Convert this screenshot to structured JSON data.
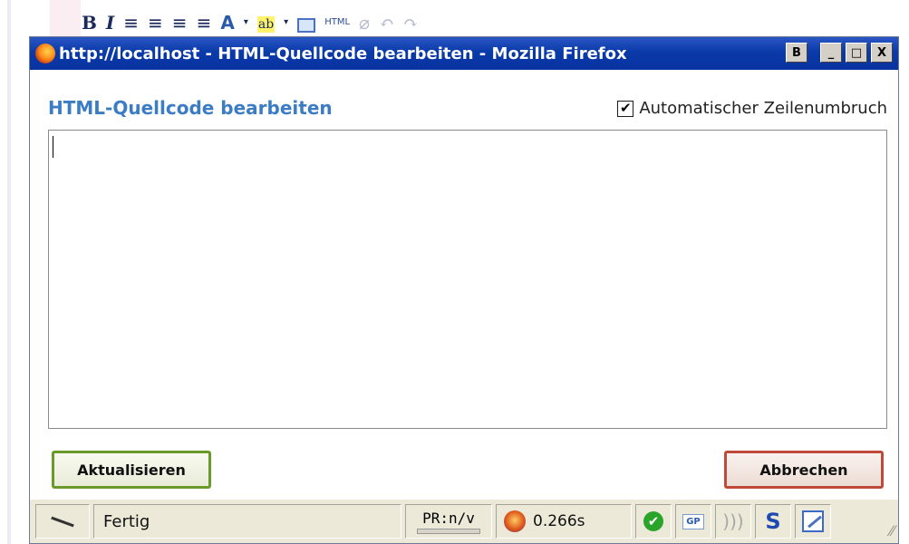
{
  "background_toolbar": {
    "bold": "B",
    "italic": "I",
    "align_left": "≡",
    "align_center": "≡",
    "align_right": "≡",
    "align_justify": "≡",
    "font_color": "A",
    "font_color_caret": "▾",
    "highlight": "ab",
    "highlight_caret": "▾",
    "html_label": "HTML",
    "undo": "↶",
    "redo": "↷"
  },
  "window": {
    "title": "http://localhost - HTML-Quellcode bearbeiten - Mozilla Firefox",
    "btn_extra": "B",
    "btn_minimize": "_",
    "btn_maximize": "□",
    "btn_close": "X"
  },
  "dialog": {
    "heading": "HTML-Quellcode bearbeiten",
    "wrap_label": "Automatischer Zeilenumbruch",
    "wrap_checked_glyph": "✔",
    "editor_content": "",
    "update_button": "Aktualisieren",
    "cancel_button": "Abbrechen"
  },
  "statusbar": {
    "status": "Fertig",
    "pagerank": "PR:n/v",
    "time": "0.266s",
    "ok_glyph": "✔",
    "gp_label": "GP",
    "rss_glyph": ")))",
    "s_label": "S",
    "grip_glyph": "⁄⁄"
  }
}
